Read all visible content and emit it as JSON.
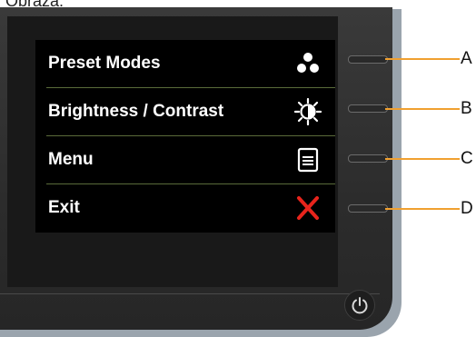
{
  "caption": "Obraza:",
  "osd": {
    "items": [
      {
        "label": "Preset Modes",
        "icon": "preset-modes-icon"
      },
      {
        "label": "Brightness / Contrast",
        "icon": "brightness-contrast-icon"
      },
      {
        "label": "Menu",
        "icon": "menu-icon"
      },
      {
        "label": "Exit",
        "icon": "exit-icon"
      }
    ]
  },
  "callouts": [
    "A",
    "B",
    "C",
    "D"
  ],
  "colors": {
    "osd_background": "#000000",
    "exit_icon": "#e8241c",
    "leader_line": "#f0a030",
    "bezel": "#2c2c2c"
  }
}
